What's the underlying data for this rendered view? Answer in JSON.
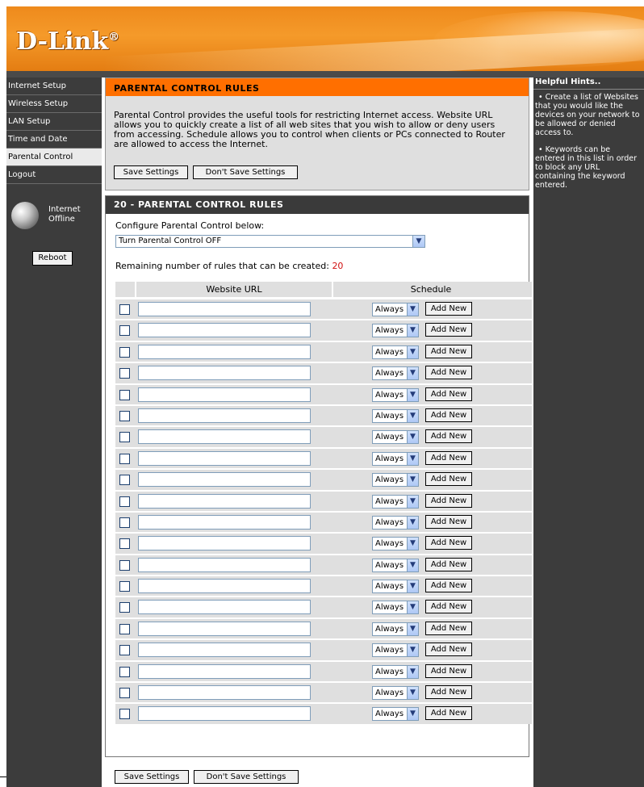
{
  "brand": {
    "logo_text": "D-Link",
    "logo_mark": "®"
  },
  "sidebar": {
    "items": [
      {
        "label": "Internet Setup"
      },
      {
        "label": "Wireless Setup"
      },
      {
        "label": "LAN Setup"
      },
      {
        "label": "Time and Date"
      },
      {
        "label": "Parental Control",
        "active": true
      },
      {
        "label": "Logout"
      }
    ],
    "status": {
      "line1": "Internet",
      "line2": "Offline",
      "icon": "globe-icon"
    },
    "reboot_label": "Reboot"
  },
  "intro": {
    "title": "PARENTAL CONTROL RULES",
    "text": "Parental Control provides the useful tools for restricting Internet access. Website URL allows you to quickly create a list of all web sites that you wish to allow or deny users from accessing. Schedule allows you to control when clients or PCs connected to Router are allowed to access the Internet.",
    "save_label": "Save Settings",
    "dont_save_label": "Don't Save Settings"
  },
  "rules": {
    "title": "20 - PARENTAL CONTROL RULES",
    "config_label": "Configure Parental Control below:",
    "config_value": "Turn Parental Control OFF",
    "remaining_label": "Remaining number of rules that can be created:",
    "remaining_count": "20",
    "col_website": "Website URL",
    "col_schedule": "Schedule",
    "row_count": 20,
    "schedule_value": "Always",
    "add_new_label": "Add New"
  },
  "footer": {
    "save_label": "Save Settings",
    "dont_save_label": "Don't Save Settings"
  },
  "hints": {
    "title": "Helpful Hints..",
    "items": [
      "Create a list of Websites that you would like the devices on your network to be allowed or denied access to.",
      "Keywords can be entered in this list in order to block any URL containing the keyword entered."
    ]
  },
  "colors": {
    "orange_header": "#ee8a1c",
    "title_bar_orange": "#ff6f00",
    "dark_panel": "#3c3c3c",
    "remaining_count": "#d01010"
  }
}
